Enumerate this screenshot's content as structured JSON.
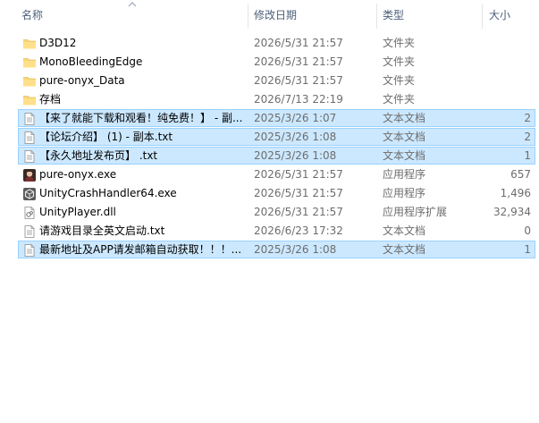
{
  "columns": {
    "name": "名称",
    "date": "修改日期",
    "type": "类型",
    "size": "大小"
  },
  "files": [
    {
      "name": "D3D12",
      "date": "2026/5/31 21:57",
      "type": "文件夹",
      "size": "",
      "icon": "folder-icon",
      "selected": false
    },
    {
      "name": "MonoBleedingEdge",
      "date": "2026/5/31 21:57",
      "type": "文件夹",
      "size": "",
      "icon": "folder-icon",
      "selected": false
    },
    {
      "name": "pure-onyx_Data",
      "date": "2026/5/31 21:57",
      "type": "文件夹",
      "size": "",
      "icon": "folder-icon",
      "selected": false
    },
    {
      "name": "存档",
      "date": "2026/7/13 22:19",
      "type": "文件夹",
      "size": "",
      "icon": "folder-icon",
      "selected": false
    },
    {
      "name": "【来了就能下载和观看！纯免费！】 - 副...",
      "date": "2025/3/26 1:07",
      "type": "文本文档",
      "size": "2",
      "icon": "text-file-icon",
      "selected": true
    },
    {
      "name": "【论坛介绍】 (1) - 副本.txt",
      "date": "2025/3/26 1:08",
      "type": "文本文档",
      "size": "2",
      "icon": "text-file-icon",
      "selected": true
    },
    {
      "name": "【永久地址发布页】 .txt",
      "date": "2025/3/26 1:08",
      "type": "文本文档",
      "size": "1",
      "icon": "text-file-icon",
      "selected": true
    },
    {
      "name": "pure-onyx.exe",
      "date": "2026/5/31 21:57",
      "type": "应用程序",
      "size": "657",
      "icon": "game-exe-icon",
      "selected": false
    },
    {
      "name": "UnityCrashHandler64.exe",
      "date": "2026/5/31 21:57",
      "type": "应用程序",
      "size": "1,496",
      "icon": "unity-exe-icon",
      "selected": false
    },
    {
      "name": "UnityPlayer.dll",
      "date": "2026/5/31 21:57",
      "type": "应用程序扩展",
      "size": "32,934",
      "icon": "dll-file-icon",
      "selected": false
    },
    {
      "name": "请游戏目录全英文启动.txt",
      "date": "2026/6/23 17:32",
      "type": "文本文档",
      "size": "0",
      "icon": "text-file-icon",
      "selected": false
    },
    {
      "name": "最新地址及APP请发邮箱自动获取！！！...",
      "date": "2025/3/26 1:08",
      "type": "文本文档",
      "size": "1",
      "icon": "text-file-icon",
      "selected": true
    }
  ]
}
